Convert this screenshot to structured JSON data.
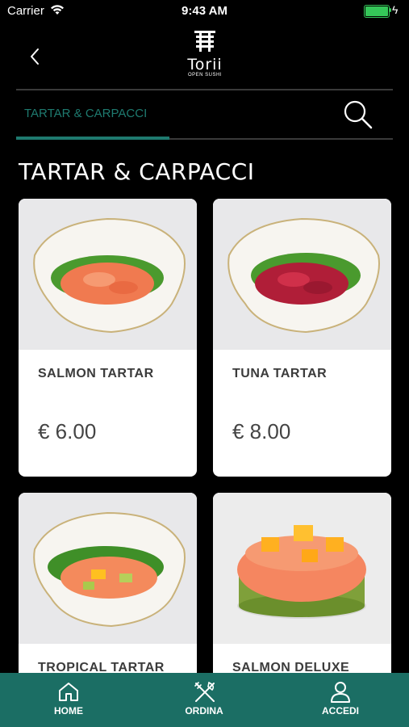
{
  "status_bar": {
    "carrier": "Carrier",
    "time": "9:43 AM"
  },
  "header": {
    "logo_brand": "Torii",
    "logo_sub": "OPEN SUSHI"
  },
  "tabs": {
    "active_label": "TARTAR & CARPACCI"
  },
  "section": {
    "title": "TARTAR & CARPACCI"
  },
  "products": [
    {
      "name": "SALMON TARTAR",
      "price": "€ 6.00"
    },
    {
      "name": "TUNA TARTAR",
      "price": "€ 8.00"
    },
    {
      "name": "TROPICAL TARTAR",
      "price": ""
    },
    {
      "name": "SALMON DELUXE",
      "price": ""
    }
  ],
  "bottom_nav": {
    "items": [
      {
        "label": "HOME",
        "icon": "home-icon"
      },
      {
        "label": "ORDINA",
        "icon": "utensils-icon"
      },
      {
        "label": "ACCEDI",
        "icon": "user-icon"
      }
    ]
  },
  "colors": {
    "accent": "#1e7a6f",
    "tabbar": "#1b6e64",
    "background": "#000000",
    "battery": "#35c759"
  }
}
